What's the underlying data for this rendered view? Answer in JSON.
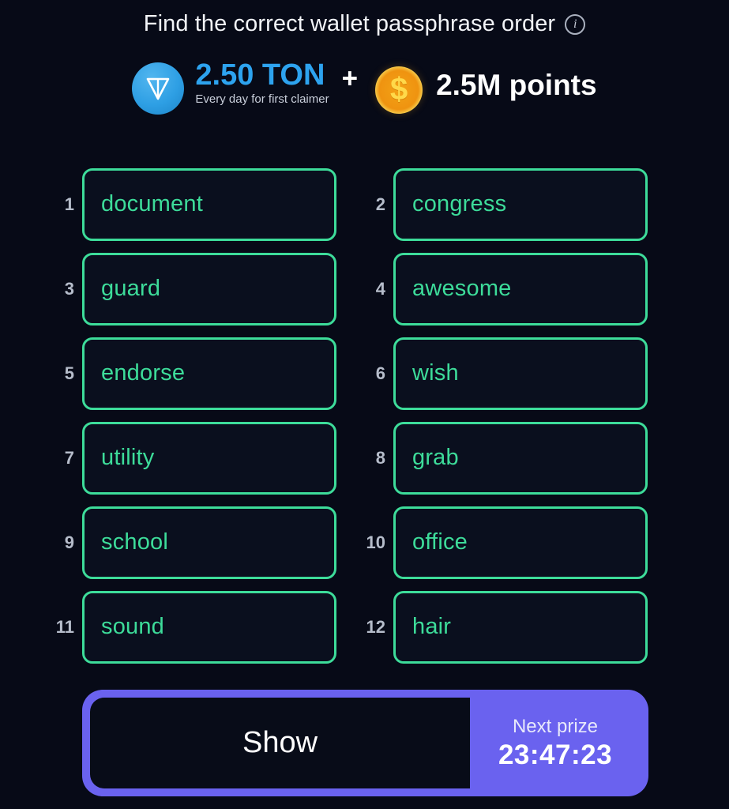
{
  "header": {
    "title": "Find the correct wallet passphrase order",
    "info_icon": "info-icon",
    "info_glyph": "i"
  },
  "prize": {
    "ton_icon": "ton-coin-icon",
    "ton_amount": "2.50 TON",
    "ton_subtitle": "Every day for first claimer",
    "plus": "+",
    "points_icon": "gold-coin-icon",
    "points_glyph": "$",
    "points_amount": "2.5M points",
    "colors": {
      "ton_blue": "#2da3ef",
      "coin_gold": "#f5c63c",
      "coin_inner": "#ef9310",
      "points_white": "#ffffff"
    }
  },
  "passphrase": {
    "accent_color": "#3ddc9a",
    "index_color": "#b6bdcb",
    "words": [
      {
        "index": "1",
        "word": "document"
      },
      {
        "index": "2",
        "word": "congress"
      },
      {
        "index": "3",
        "word": "guard"
      },
      {
        "index": "4",
        "word": "awesome"
      },
      {
        "index": "5",
        "word": "endorse"
      },
      {
        "index": "6",
        "word": "wish"
      },
      {
        "index": "7",
        "word": "utility"
      },
      {
        "index": "8",
        "word": "grab"
      },
      {
        "index": "9",
        "word": "school"
      },
      {
        "index": "10",
        "word": "office"
      },
      {
        "index": "11",
        "word": "sound"
      },
      {
        "index": "12",
        "word": "hair"
      }
    ]
  },
  "bottom": {
    "show_label": "Show",
    "next_prize_label": "Next prize",
    "next_prize_timer": "23:47:23",
    "accent_color": "#6a62ef"
  }
}
